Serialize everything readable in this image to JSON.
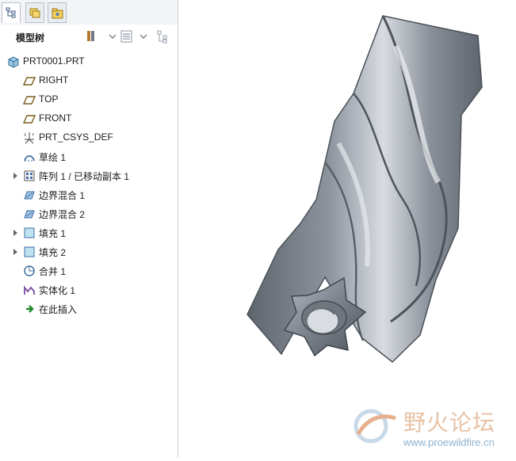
{
  "panel": {
    "title": "模型树",
    "tabs": [
      "model-tree-tab",
      "layers-tab",
      "folder-tab"
    ]
  },
  "tree": {
    "root": "PRT0001.PRT",
    "items": [
      {
        "label": "RIGHT",
        "icon": "datum-plane-icon",
        "expandable": false
      },
      {
        "label": "TOP",
        "icon": "datum-plane-icon",
        "expandable": false
      },
      {
        "label": "FRONT",
        "icon": "datum-plane-icon",
        "expandable": false
      },
      {
        "label": "PRT_CSYS_DEF",
        "icon": "coordinate-system-icon",
        "expandable": false
      },
      {
        "label": "草绘 1",
        "icon": "sketch-icon",
        "expandable": false
      },
      {
        "label": "阵列 1 / 已移动副本 1",
        "icon": "pattern-icon",
        "expandable": true
      },
      {
        "label": "边界混合 1",
        "icon": "boundary-blend-icon",
        "expandable": false
      },
      {
        "label": "边界混合 2",
        "icon": "boundary-blend-icon",
        "expandable": false
      },
      {
        "label": "填充 1",
        "icon": "fill-icon",
        "expandable": true
      },
      {
        "label": "填充 2",
        "icon": "fill-icon",
        "expandable": true
      },
      {
        "label": "合并 1",
        "icon": "merge-icon",
        "expandable": false
      },
      {
        "label": "实体化 1",
        "icon": "solidify-icon",
        "expandable": false
      },
      {
        "label": "在此插入",
        "icon": "insert-here-arrow-icon",
        "expandable": false
      }
    ]
  },
  "watermark": {
    "name": "野火论坛",
    "url": "www.proewildfire.cn"
  },
  "colors": {
    "model_fill": "#8a9099",
    "model_dark": "#5f656d",
    "model_light": "#c7cbd1",
    "panel_border": "#c9ced6"
  }
}
